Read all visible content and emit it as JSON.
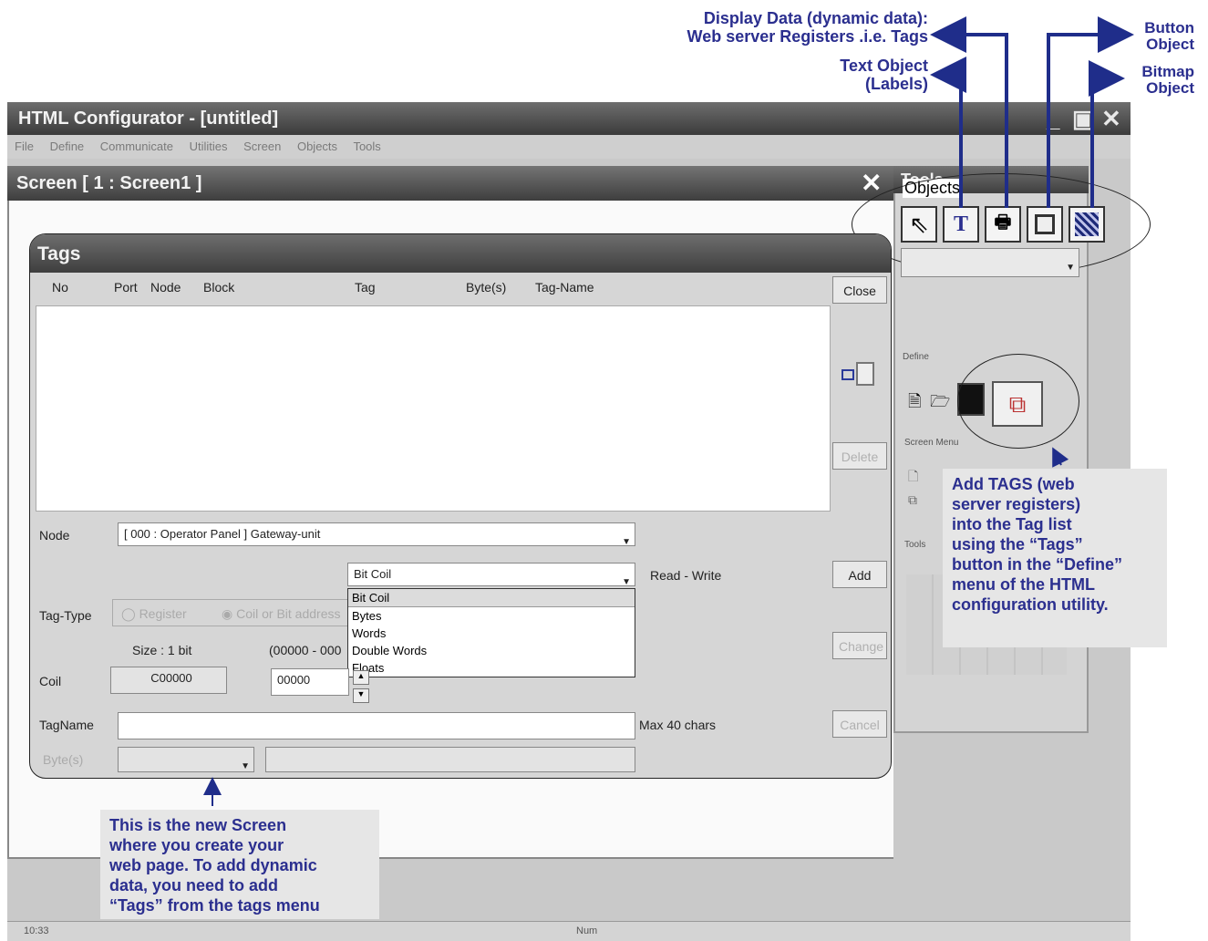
{
  "app": {
    "title": "HTML Configurator - [untitled]"
  },
  "menu": [
    "File",
    "Define",
    "Communicate",
    "Utilities",
    "Screen",
    "Objects",
    "Tools"
  ],
  "screen": {
    "title": "Screen [ 1 : Screen1 ]"
  },
  "tools_panel": {
    "title": "Tools",
    "objects_label": "Objects",
    "define_label": "Define",
    "screen_menu_label": "Screen Menu",
    "tools_label": "Tools"
  },
  "tags_dialog": {
    "title": "Tags",
    "columns": [
      "No",
      "Port",
      "Node",
      "Block",
      "Tag",
      "Byte(s)",
      "Tag-Name"
    ],
    "node_label": "Node",
    "node_value": "[ 000 : Operator Panel ]  Gateway-unit",
    "type_selected": "Bit Coil",
    "access": "Read - Write",
    "tag_type_label": "Tag-Type",
    "radio_register": "Register",
    "radio_coil": "Coil or Bit address",
    "size_text": "Size : 1 bit",
    "range_text": "(00000 - 000",
    "coil_label": "Coil",
    "coil_address": "C00000",
    "coil_value": "00000",
    "tagname_label": "TagName",
    "max_chars": "Max 40 chars",
    "bytes_label": "Byte(s)",
    "dropdown_options": [
      "Bit Coil",
      "Bytes",
      "Words",
      "Double Words",
      "Floats"
    ],
    "buttons": {
      "close": "Close",
      "delete": "Delete",
      "add": "Add",
      "change": "Change",
      "cancel": "Cancel"
    }
  },
  "callouts": {
    "display_data": "Display Data (dynamic data):\nWeb server Registers .i.e. Tags",
    "text_object": "Text Object\n(Labels)",
    "button_object": "Button\nObject",
    "bitmap_object": "Bitmap\nObject",
    "add_tags": "Add TAGS (web\nserver registers)\ninto the Tag list\nusing the “Tags”\nbutton in the “Define”\nmenu of the HTML\nconfiguration utility.",
    "new_screen": "This is the new Screen\nwhere you create your\nweb page. To add dynamic\ndata, you need to add\n“Tags” from the tags menu"
  },
  "statusbar": {
    "time": "10:33",
    "num": "Num"
  },
  "colors": {
    "callout": "#2b2f8f",
    "titlebar": "#4a4a4a"
  }
}
